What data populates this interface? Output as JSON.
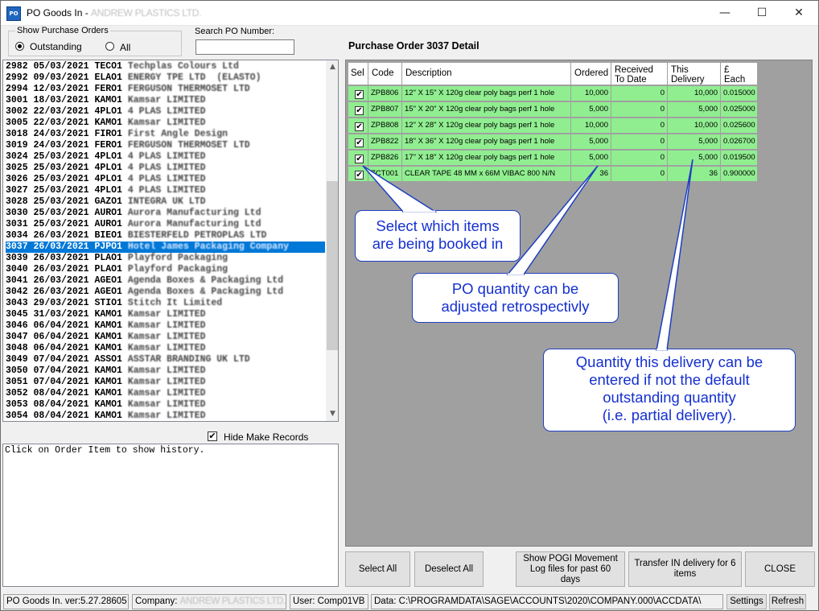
{
  "window": {
    "title_prefix": "PO Goods In - ",
    "title_company": "ANDREW PLASTICS LTD.",
    "minimize": "—",
    "maximize": "☐",
    "close": "✕",
    "app_icon": "PO"
  },
  "filter": {
    "group_label": "Show Purchase Orders",
    "outstanding_label": "Outstanding",
    "all_label": "All",
    "selected": "Outstanding"
  },
  "search": {
    "label": "Search PO Number:",
    "value": ""
  },
  "po_list": [
    {
      "no": "2982",
      "date": "05/03/2021",
      "code": "TECO1",
      "name": "Techplas Colours Ltd",
      "selected": false
    },
    {
      "no": "2992",
      "date": "09/03/2021",
      "code": "ELAO1",
      "name": "ENERGY TPE LTD  (ELASTO)",
      "selected": false
    },
    {
      "no": "2994",
      "date": "12/03/2021",
      "code": "FERO1",
      "name": "FERGUSON THERMOSET LTD",
      "selected": false
    },
    {
      "no": "3001",
      "date": "18/03/2021",
      "code": "KAMO1",
      "name": "Kamsar LIMITED",
      "selected": false
    },
    {
      "no": "3002",
      "date": "22/03/2021",
      "code": "4PLO1",
      "name": "4 PLAS LIMITED",
      "selected": false
    },
    {
      "no": "3005",
      "date": "22/03/2021",
      "code": "KAMO1",
      "name": "Kamsar LIMITED",
      "selected": false
    },
    {
      "no": "3018",
      "date": "24/03/2021",
      "code": "FIRO1",
      "name": "First Angle Design",
      "selected": false
    },
    {
      "no": "3019",
      "date": "24/03/2021",
      "code": "FERO1",
      "name": "FERGUSON THERMOSET LTD",
      "selected": false
    },
    {
      "no": "3024",
      "date": "25/03/2021",
      "code": "4PLO1",
      "name": "4 PLAS LIMITED",
      "selected": false
    },
    {
      "no": "3025",
      "date": "25/03/2021",
      "code": "4PLO1",
      "name": "4 PLAS LIMITED",
      "selected": false
    },
    {
      "no": "3026",
      "date": "25/03/2021",
      "code": "4PLO1",
      "name": "4 PLAS LIMITED",
      "selected": false
    },
    {
      "no": "3027",
      "date": "25/03/2021",
      "code": "4PLO1",
      "name": "4 PLAS LIMITED",
      "selected": false
    },
    {
      "no": "3028",
      "date": "25/03/2021",
      "code": "GAZO1",
      "name": "INTEGRA UK LTD",
      "selected": false
    },
    {
      "no": "3030",
      "date": "25/03/2021",
      "code": "AURO1",
      "name": "Aurora Manufacturing Ltd",
      "selected": false
    },
    {
      "no": "3031",
      "date": "25/03/2021",
      "code": "AURO1",
      "name": "Aurora Manufacturing Ltd",
      "selected": false
    },
    {
      "no": "3034",
      "date": "26/03/2021",
      "code": "BIEO1",
      "name": "BIESTERFELD PETROPLAS LTD",
      "selected": false
    },
    {
      "no": "3037",
      "date": "26/03/2021",
      "code": "PJPO1",
      "name": "Hotel James Packaging Company",
      "selected": true
    },
    {
      "no": "3039",
      "date": "26/03/2021",
      "code": "PLAO1",
      "name": "Playford Packaging",
      "selected": false
    },
    {
      "no": "3040",
      "date": "26/03/2021",
      "code": "PLAO1",
      "name": "Playford Packaging",
      "selected": false
    },
    {
      "no": "3041",
      "date": "26/03/2021",
      "code": "AGEO1",
      "name": "Agenda Boxes & Packaging Ltd",
      "selected": false
    },
    {
      "no": "3042",
      "date": "26/03/2021",
      "code": "AGEO1",
      "name": "Agenda Boxes & Packaging Ltd",
      "selected": false
    },
    {
      "no": "3043",
      "date": "29/03/2021",
      "code": "STIO1",
      "name": "Stitch It Limited",
      "selected": false
    },
    {
      "no": "3045",
      "date": "31/03/2021",
      "code": "KAMO1",
      "name": "Kamsar LIMITED",
      "selected": false
    },
    {
      "no": "3046",
      "date": "06/04/2021",
      "code": "KAMO1",
      "name": "Kamsar LIMITED",
      "selected": false
    },
    {
      "no": "3047",
      "date": "06/04/2021",
      "code": "KAMO1",
      "name": "Kamsar LIMITED",
      "selected": false
    },
    {
      "no": "3048",
      "date": "06/04/2021",
      "code": "KAMO1",
      "name": "Kamsar LIMITED",
      "selected": false
    },
    {
      "no": "3049",
      "date": "07/04/2021",
      "code": "ASSO1",
      "name": "ASSTAR BRANDING UK LTD",
      "selected": false
    },
    {
      "no": "3050",
      "date": "07/04/2021",
      "code": "KAMO1",
      "name": "Kamsar LIMITED",
      "selected": false
    },
    {
      "no": "3051",
      "date": "07/04/2021",
      "code": "KAMO1",
      "name": "Kamsar LIMITED",
      "selected": false
    },
    {
      "no": "3052",
      "date": "08/04/2021",
      "code": "KAMO1",
      "name": "Kamsar LIMITED",
      "selected": false
    },
    {
      "no": "3053",
      "date": "08/04/2021",
      "code": "KAMO1",
      "name": "Kamsar LIMITED",
      "selected": false
    },
    {
      "no": "3054",
      "date": "08/04/2021",
      "code": "KAMO1",
      "name": "Kamsar LIMITED",
      "selected": false
    }
  ],
  "hide_make": {
    "label": "Hide Make Records",
    "checked": true,
    "mark": "✔"
  },
  "history_text": "Click on Order Item to show history.",
  "detail": {
    "title": "Purchase Order 3037 Detail",
    "headers": {
      "sel": "Sel",
      "code": "Code",
      "description": "Description",
      "ordered": "Ordered",
      "received": [
        "Received",
        "To Date"
      ],
      "this_delivery": [
        "This",
        "Delivery"
      ],
      "each": [
        "£",
        "Each"
      ]
    },
    "rows": [
      {
        "sel": true,
        "code": "ZPB806",
        "description": "12\" X 15\" X 120g  clear poly bags perf 1 hole",
        "ordered": "10,000",
        "received": "0",
        "this_delivery": "10,000",
        "each": "0.015000"
      },
      {
        "sel": true,
        "code": "ZPB807",
        "description": "15\" X 20\" X 120g  clear poly bags perf 1 hole",
        "ordered": "5,000",
        "received": "0",
        "this_delivery": "5,000",
        "each": "0.025000"
      },
      {
        "sel": true,
        "code": "ZPB808",
        "description": "12\" X 28\" X 120g  clear poly bags perf 1 hole",
        "ordered": "10,000",
        "received": "0",
        "this_delivery": "10,000",
        "each": "0.025600"
      },
      {
        "sel": true,
        "code": "ZPB822",
        "description": "18\" X 36\" X 120g  clear poly bags perf 1 hole",
        "ordered": "5,000",
        "received": "0",
        "this_delivery": "5,000",
        "each": "0.026700"
      },
      {
        "sel": true,
        "code": "ZPB826",
        "description": "17\" X 18\" X 120g  clear poly bags perf 1 hole",
        "ordered": "5,000",
        "received": "0",
        "this_delivery": "5,000",
        "each": "0.019500"
      },
      {
        "sel": true,
        "code": "ZCT001",
        "description": "CLEAR TAPE 48 MM x 66M  VIBAC  800   N/N",
        "ordered": "36",
        "received": "0",
        "this_delivery": "36",
        "each": "0.900000"
      }
    ],
    "check_mark": "✔"
  },
  "callouts": {
    "select": [
      "Select which items",
      "are being booked in"
    ],
    "po_qty": [
      "PO quantity can be",
      "adjusted retrospectivly"
    ],
    "delivery": [
      "Quantity this delivery can be",
      "entered if not the default",
      "outstanding quantity",
      "(i.e. partial delivery)."
    ]
  },
  "buttons": {
    "select_all": "Select All",
    "deselect_all": "Deselect All",
    "show_pogi": "Show POGI Movement Log files for past 60 days",
    "transfer": "Transfer IN delivery for 6 items",
    "close": "CLOSE"
  },
  "status": {
    "version": "PO Goods In. ver:5.27.28605",
    "company_label": "Company: ",
    "company_value": "ANDREW PLASTICS LTD.",
    "user": "User: Comp01VB",
    "data_path": "Data: C:\\PROGRAMDATA\\SAGE\\ACCOUNTS\\2020\\COMPANY.000\\ACCDATA\\",
    "settings": "Settings",
    "refresh": "Refresh"
  },
  "icons": {
    "scroll_up": "▲",
    "scroll_down": "▼"
  },
  "colors": {
    "grid_row": "#90ee90",
    "selection": "#0078d7",
    "callout_text": "#1530d0"
  }
}
